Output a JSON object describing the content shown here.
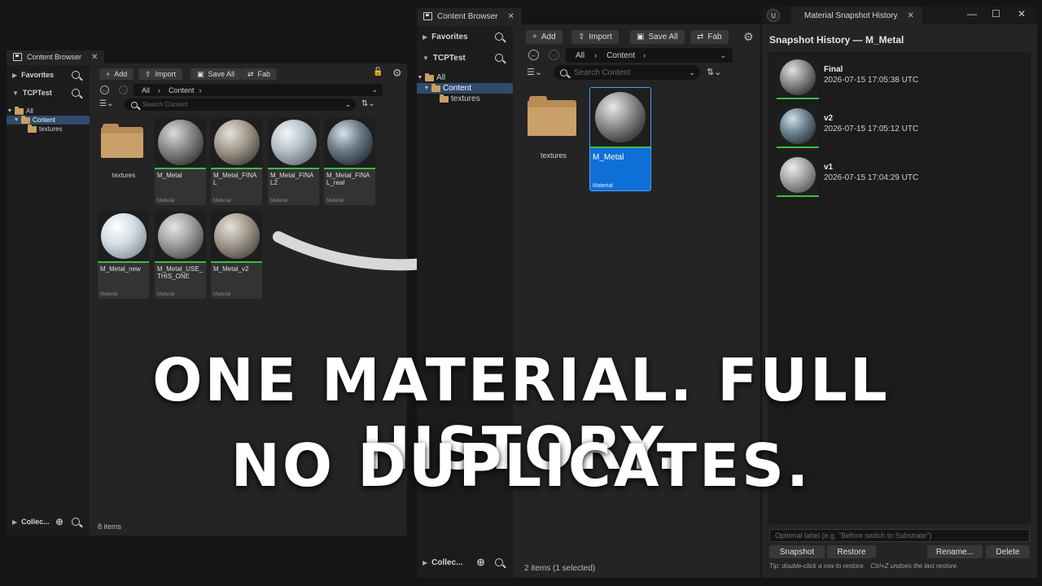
{
  "left_browser": {
    "tab_title": "Content Browser",
    "favorites": "Favorites",
    "project": "TCPTest",
    "tree": {
      "all": "All",
      "content": "Content",
      "textures": "textures"
    },
    "collections": "Collec...",
    "toolbar": {
      "add": "Add",
      "import": "Import",
      "save_all": "Save All",
      "fab": "Fab"
    },
    "path": {
      "root": "All",
      "folder": "Content"
    },
    "search_placeholder": "Search Content",
    "items_count": "8 items",
    "folder_tile": "textures",
    "assets": [
      {
        "name": "M_Metal",
        "type": "Material"
      },
      {
        "name": "M_Metal_FINAL",
        "type": "Material"
      },
      {
        "name": "M_Metal_FINAL2",
        "type": "Material"
      },
      {
        "name": "M_Metal_FINAL_real",
        "type": "Material"
      },
      {
        "name": "M_Metal_new",
        "type": "Material"
      },
      {
        "name": "M_Metal_USE_THIS_ONE",
        "type": "Material"
      },
      {
        "name": "M_Metal_v2",
        "type": "Material"
      }
    ]
  },
  "right_browser": {
    "tab_title": "Content Browser",
    "favorites": "Favorites",
    "project": "TCPTest",
    "tree": {
      "all": "All",
      "content": "Content",
      "textures": "textures"
    },
    "collections": "Collec...",
    "toolbar": {
      "add": "Add",
      "import": "Import",
      "save_all": "Save All",
      "fab": "Fab"
    },
    "path": {
      "root": "All",
      "folder": "Content"
    },
    "search_placeholder": "Search Content",
    "items_count": "2 items (1 selected)",
    "folder_tile": "textures",
    "asset": {
      "name": "M_Metal",
      "type": "Material"
    }
  },
  "history": {
    "tab_title": "Material Snapshot History",
    "heading": "Snapshot History — M_Metal",
    "snapshots": [
      {
        "label": "Final",
        "time": "2026-07-15 17:05:38 UTC"
      },
      {
        "label": "v2",
        "time": "2026-07-15 17:05:12 UTC"
      },
      {
        "label": "v1",
        "time": "2026-07-15 17:04:29 UTC"
      }
    ],
    "label_placeholder": "Optional label (e.g. \"Before switch to Substrate\")",
    "buttons": {
      "snapshot": "Snapshot",
      "restore": "Restore",
      "rename": "Rename...",
      "delete": "Delete"
    },
    "tip": "Tip: double-click a row to restore.   Ctrl+Z undoes the last restore."
  },
  "headline": {
    "line1": "ONE MATERIAL. FULL HISTORY.",
    "line2": "NO DUPLICATES."
  },
  "colors": {
    "accent_green": "#3cbc44",
    "selection_blue": "#0f6fd8",
    "folder": "#b88c55"
  }
}
